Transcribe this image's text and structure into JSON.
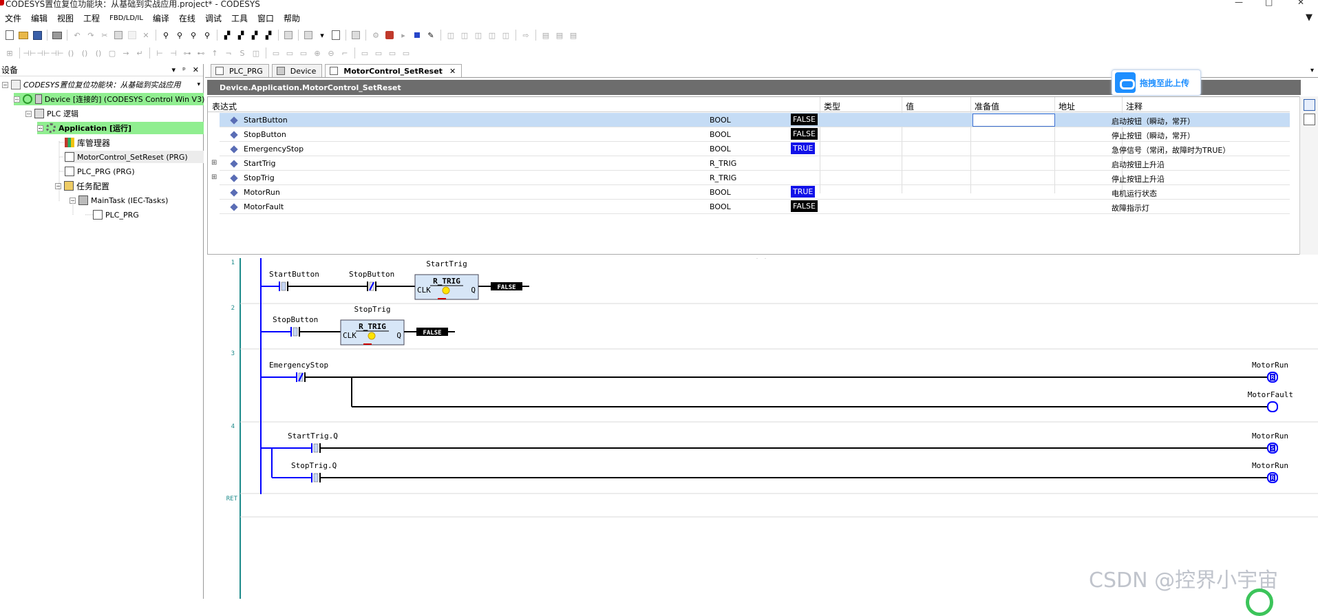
{
  "titlebar": {
    "title": "CODESYS置位复位功能块：从基础到实战应用.project* - CODESYS",
    "min": "—",
    "max": "□",
    "close": "✕"
  },
  "menu": [
    "文件",
    "编辑",
    "视图",
    "工程",
    "FBD/LD/IL",
    "编译",
    "在线",
    "调试",
    "工具",
    "窗口",
    "帮助"
  ],
  "left_panel": {
    "title": "设备",
    "buttons": [
      "▾",
      "ᵖ",
      "✕"
    ],
    "tree": [
      {
        "label": "CODESYS置位复位功能块：从基础到实战应用",
        "icon": "project-icon"
      },
      {
        "label": "Device [连接的] (CODESYS Control Win V3)",
        "icon": "device-icon"
      },
      {
        "label": "PLC 逻辑",
        "icon": "plc-logic-icon"
      },
      {
        "label": "Application [运行]",
        "icon": "application-gear-icon"
      },
      {
        "label": "库管理器",
        "icon": "library-icon"
      },
      {
        "label": "MotorControl_SetReset (PRG)",
        "icon": "program-icon"
      },
      {
        "label": "PLC_PRG (PRG)",
        "icon": "program-icon"
      },
      {
        "label": "任务配置",
        "icon": "task-config-icon"
      },
      {
        "label": "MainTask (IEC-Tasks)",
        "icon": "task-icon"
      },
      {
        "label": "PLC_PRG",
        "icon": "program-call-icon"
      }
    ]
  },
  "tabs": [
    {
      "label": "PLC_PRG",
      "active": false
    },
    {
      "label": "Device",
      "active": false
    },
    {
      "label": "MotorControl_SetReset",
      "active": true
    }
  ],
  "tab_dropdown": "▾",
  "path": "Device.Application.MotorControl_SetReset",
  "upload_button": "拖拽至此上传",
  "watch_table": {
    "headers": [
      "表达式",
      "类型",
      "值",
      "准备值",
      "地址",
      "注释"
    ],
    "rows": [
      {
        "name": "StartButton",
        "type": "BOOL",
        "value": "FALSE",
        "comment": "启动按钮（瞬动，常开）",
        "selected": true,
        "expand": ""
      },
      {
        "name": "StopButton",
        "type": "BOOL",
        "value": "FALSE",
        "comment": "停止按钮（瞬动，常开）",
        "selected": false,
        "expand": ""
      },
      {
        "name": "EmergencyStop",
        "type": "BOOL",
        "value": "TRUE",
        "comment": "急停信号（常闭，故障时为TRUE）",
        "selected": false,
        "expand": ""
      },
      {
        "name": "StartTrig",
        "type": "R_TRIG",
        "value": "",
        "comment": "启动按钮上升沿",
        "selected": false,
        "expand": "⊞"
      },
      {
        "name": "StopTrig",
        "type": "R_TRIG",
        "value": "",
        "comment": "停止按钮上升沿",
        "selected": false,
        "expand": "⊞"
      },
      {
        "name": "MotorRun",
        "type": "BOOL",
        "value": "TRUE",
        "comment": "电机运行状态",
        "selected": false,
        "expand": ""
      },
      {
        "name": "MotorFault",
        "type": "BOOL",
        "value": "FALSE",
        "comment": "故障指示灯",
        "selected": false,
        "expand": ""
      }
    ]
  },
  "ladder": {
    "networks": [
      {
        "num": "1",
        "contacts": [
          {
            "label": "StartButton",
            "type": "NO"
          },
          {
            "label": "StopButton",
            "type": "NC"
          }
        ],
        "block": {
          "instance": "StartTrig",
          "type": "R_TRIG",
          "in": "CLK",
          "out": "Q"
        },
        "output_value": "FALSE"
      },
      {
        "num": "2",
        "contacts": [
          {
            "label": "StopButton",
            "type": "NO"
          }
        ],
        "block": {
          "instance": "StopTrig",
          "type": "R_TRIG",
          "in": "CLK",
          "out": "Q"
        },
        "output_value": "FALSE"
      },
      {
        "num": "3",
        "contacts": [
          {
            "label": "EmergencyStop",
            "type": "NC"
          }
        ],
        "coils": [
          {
            "label": "MotorRun",
            "type": "R"
          },
          {
            "label": "MotorFault",
            "type": "coil"
          }
        ]
      },
      {
        "num": "4",
        "contacts": [
          {
            "label": "StartTrig.Q",
            "type": "NO"
          },
          {
            "label": "StopTrig.Q",
            "type": "NO"
          }
        ],
        "coils": [
          {
            "label": "MotorRun",
            "type": "S"
          },
          {
            "label": "MotorRun",
            "type": "R"
          }
        ]
      }
    ],
    "ret": "RET"
  },
  "watermark": "CSDN @控界小宇宙",
  "colors": {
    "accent": "#1212e8",
    "active_rung": "#0000ff",
    "path_bar": "#6d6d6d",
    "online_green": "#90ee90"
  }
}
